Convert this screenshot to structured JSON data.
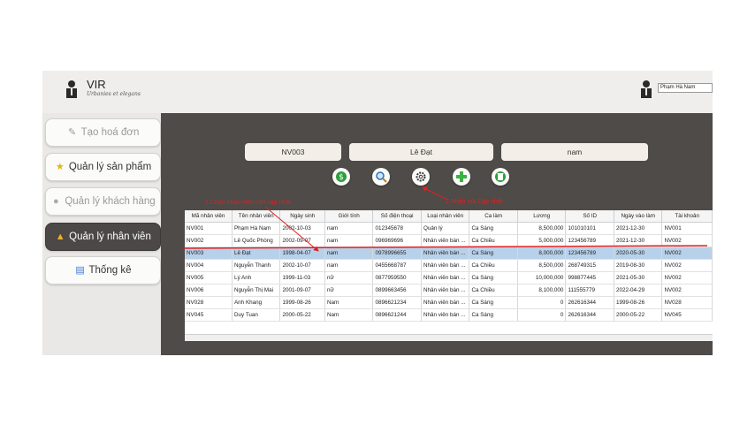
{
  "header": {
    "brand": "VIR",
    "slogan": "Urbanies et elegans",
    "user_name": "Phạm Hà Nam"
  },
  "sidebar": {
    "items": [
      {
        "label": "Tạo hoá đơn",
        "icon": "invoice-icon",
        "state": "dim"
      },
      {
        "label": "Quản lý sản phẩm",
        "icon": "star-icon",
        "state": "normal"
      },
      {
        "label": "Quản lý khách hàng",
        "icon": "user-icon",
        "state": "dim"
      },
      {
        "label": "Quản lý nhân viên",
        "icon": "staff-icon",
        "state": "active"
      },
      {
        "label": "Thống kê",
        "icon": "report-icon",
        "state": "normal"
      }
    ]
  },
  "form": {
    "employee_id": "NV003",
    "employee_name": "Lê Đạt",
    "gender": "nam"
  },
  "toolbar": {
    "icons": [
      "money-icon",
      "search-icon",
      "gear-icon",
      "add-icon",
      "delete-icon"
    ]
  },
  "annotations": {
    "select_row": "1.Chọn nhân viên cần cập nhật",
    "update": "2.Nhấn nút Cập nhật"
  },
  "colors": {
    "main_bg": "#4e4b48",
    "selected_row": "#b8d1ea",
    "annotation": "#e02020",
    "active_nav": "#4b4845"
  },
  "table": {
    "columns": [
      "Mã nhân viên",
      "Tên nhân viên",
      "Ngày sinh",
      "Giới tính",
      "Số điện thoại",
      "Loại nhân viên",
      "Ca làm",
      "Lương",
      "Số ID",
      "Ngày vào làm",
      "Tài khoản"
    ],
    "selected_index": 2,
    "rows": [
      [
        "NV001",
        "Phạm Hà Nam",
        "2002-10-03",
        "nam",
        "012345678",
        "Quản lý",
        "Ca Sáng",
        "8,500,000",
        "101010101",
        "2021-12-30",
        "NV001"
      ],
      [
        "NV002",
        "Lê Quốc Phòng",
        "2002-09-07",
        "nam",
        "096969696",
        "Nhân viên bán ...",
        "Ca Chiều",
        "5,000,000",
        "123456789",
        "2021-12-30",
        "NV002"
      ],
      [
        "NV003",
        "Lê Đạt",
        "1998-04-07",
        "nam",
        "0978996655",
        "Nhân viên bán ...",
        "Ca Sáng",
        "8,000,000",
        "123456789",
        "2020-05-30",
        "NV002"
      ],
      [
        "NV004",
        "Nguyễn Thanh",
        "2002-10-07",
        "nam",
        "0455668787",
        "Nhân viên bán ...",
        "Ca Chiều",
        "8,500,000",
        "268749315",
        "2019-08-30",
        "NV002"
      ],
      [
        "NV005",
        "Lý Anh",
        "1999-11-03",
        "nữ",
        "0877959550",
        "Nhân viên bán ...",
        "Ca Sáng",
        "10,000,000",
        "998877445",
        "2021-05-30",
        "NV002"
      ],
      [
        "NV006",
        "Nguyễn Thị Mai",
        "2001-09-07",
        "nữ",
        "0899663456",
        "Nhân viên bán ...",
        "Ca Chiều",
        "8,100,000",
        "111555779",
        "2022-04-29",
        "NV002"
      ],
      [
        "NV028",
        "Anh Khang",
        "1999-08-26",
        "Nam",
        "0896621234",
        "Nhân viên bán ...",
        "Ca Sáng",
        "0",
        "262616344",
        "1999-08-26",
        "NV028"
      ],
      [
        "NV045",
        "Duy Tuan",
        "2000-05-22",
        "Nam",
        "0896621244",
        "Nhân viên bán ...",
        "Ca Sáng",
        "0",
        "262616344",
        "2000-05-22",
        "NV045"
      ]
    ]
  }
}
